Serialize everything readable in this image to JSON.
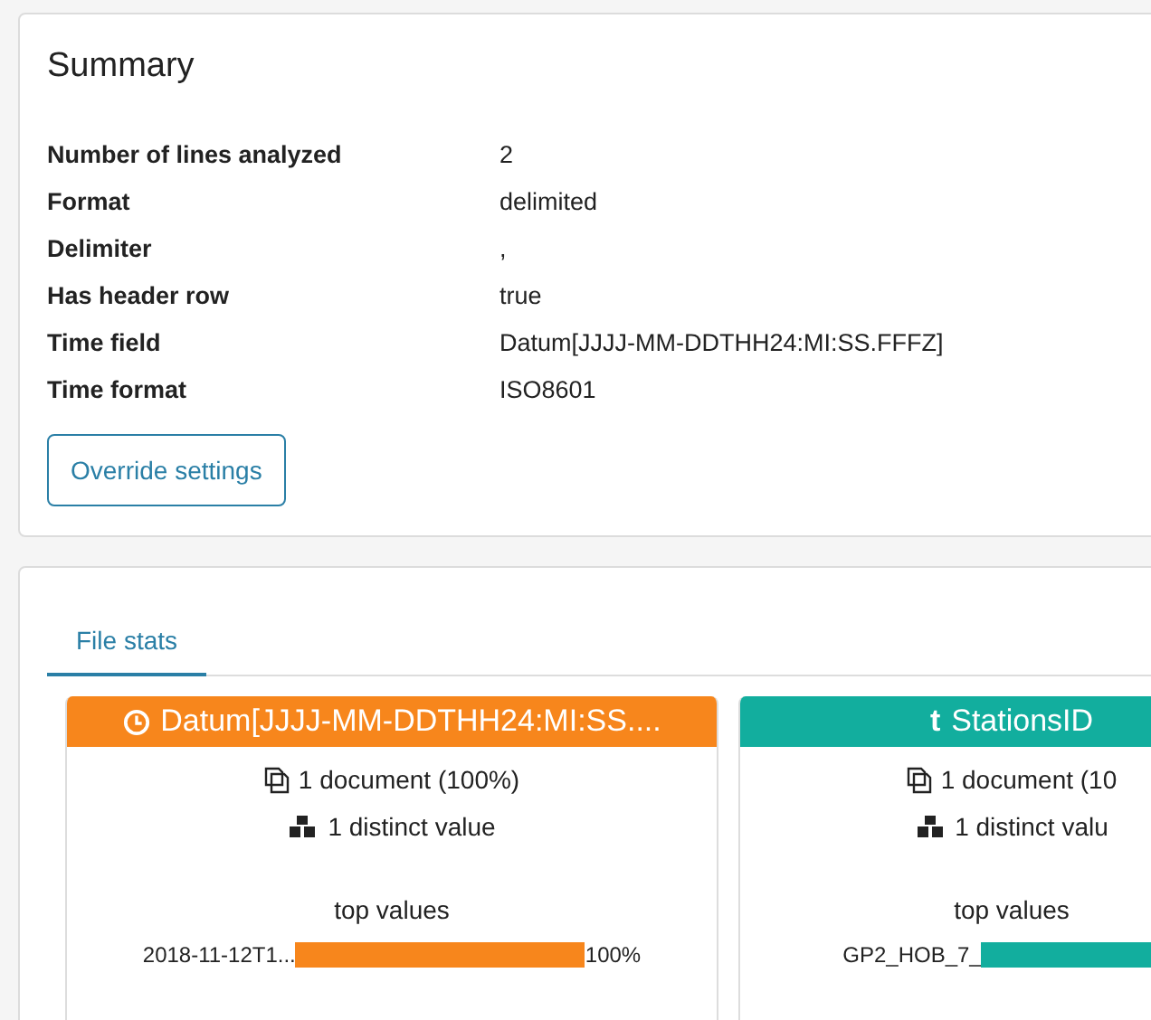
{
  "summary": {
    "title": "Summary",
    "rows": [
      {
        "label": "Number of lines analyzed",
        "value": "2"
      },
      {
        "label": "Format",
        "value": "delimited"
      },
      {
        "label": "Delimiter",
        "value": ","
      },
      {
        "label": "Has header row",
        "value": "true"
      },
      {
        "label": "Time field",
        "value": "Datum[JJJJ-MM-DDTHH24:MI:SS.FFFZ]"
      },
      {
        "label": "Time format",
        "value": "ISO8601"
      }
    ],
    "button": "Override settings"
  },
  "tabs": [
    {
      "label": "File stats",
      "selected": true
    }
  ],
  "fields": [
    {
      "kind": "date",
      "color": "#f7861c",
      "name": "Datum[JJJJ-MM-DDTHH24:MI:SS....",
      "documents": "1 document (100%)",
      "distinct": "1 distinct value",
      "top_values_title": "top values",
      "top_values": [
        {
          "value": "2018-11-12T1...",
          "percent": "100%"
        }
      ]
    },
    {
      "kind": "text",
      "color": "#12ae9e",
      "type_glyph": "t",
      "name": "StationsID",
      "documents": "1 document (10",
      "distinct": "1 distinct valu",
      "top_values_title": "top values",
      "top_values": [
        {
          "value": "GP2_HOB_7_"
        }
      ]
    }
  ]
}
